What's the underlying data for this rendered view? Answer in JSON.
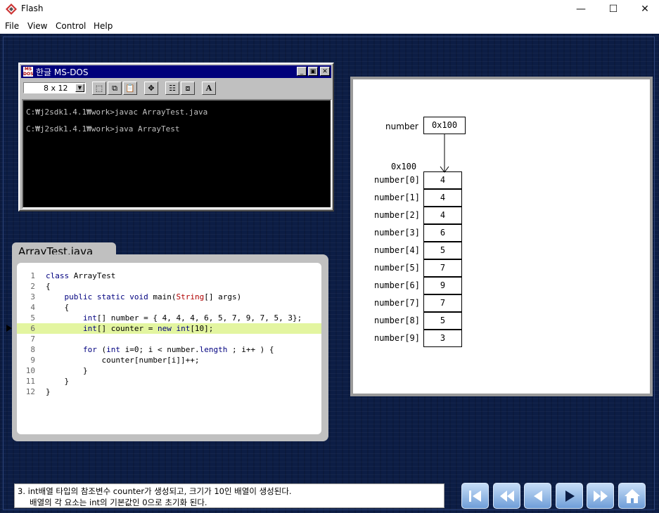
{
  "window": {
    "title": "Flash",
    "controls": [
      "—",
      "☐",
      "✕"
    ]
  },
  "menu": {
    "items": [
      "File",
      "View",
      "Control",
      "Help"
    ]
  },
  "dos": {
    "title": "한글 MS-DOS",
    "icon_text": "MS DOS",
    "font_size_value": "8 x 12",
    "lines": [
      "C:₩j2sdk1.4.1₩work>javac ArrayTest.java",
      "C:₩j2sdk1.4.1₩work>java ArrayTest"
    ]
  },
  "code": {
    "tab_label": "ArrayTest.java",
    "current_line": 6,
    "line_numbers": [
      "1",
      "2",
      "3",
      "4",
      "5",
      "6",
      "7",
      "8",
      "9",
      "10",
      "11",
      "12"
    ],
    "lines": [
      "class ArrayTest",
      "{",
      "    public static void main(String[] args)",
      "    {",
      "        int[] number = { 4, 4, 4, 6, 5, 7, 9, 7, 5, 3};",
      "        int[] counter = new int[10];",
      "",
      "        for (int i=0; i < number.length ; i++ ) {",
      "            counter[number[i]]++;",
      "        }",
      "    }",
      "}"
    ]
  },
  "diagram": {
    "ref_label": "number",
    "ref_value": "0x100",
    "array_address": "0x100",
    "labels": [
      "number[0]",
      "number[1]",
      "number[2]",
      "number[3]",
      "number[4]",
      "number[5]",
      "number[6]",
      "number[7]",
      "number[8]",
      "number[9]"
    ],
    "values": [
      "4",
      "4",
      "4",
      "6",
      "5",
      "7",
      "9",
      "7",
      "5",
      "3"
    ]
  },
  "caption": {
    "line1": "3. int배열 타입의 참조변수 counter가 생성되고, 크기가 10인 배열이 생성된다.",
    "line2": "배열의 각 요소는 int의 기본값인 0으로 초기화 된다."
  },
  "nav": {
    "buttons": [
      "first-icon",
      "rewind-icon",
      "back-icon",
      "play-icon",
      "forward-icon",
      "home-icon"
    ]
  }
}
